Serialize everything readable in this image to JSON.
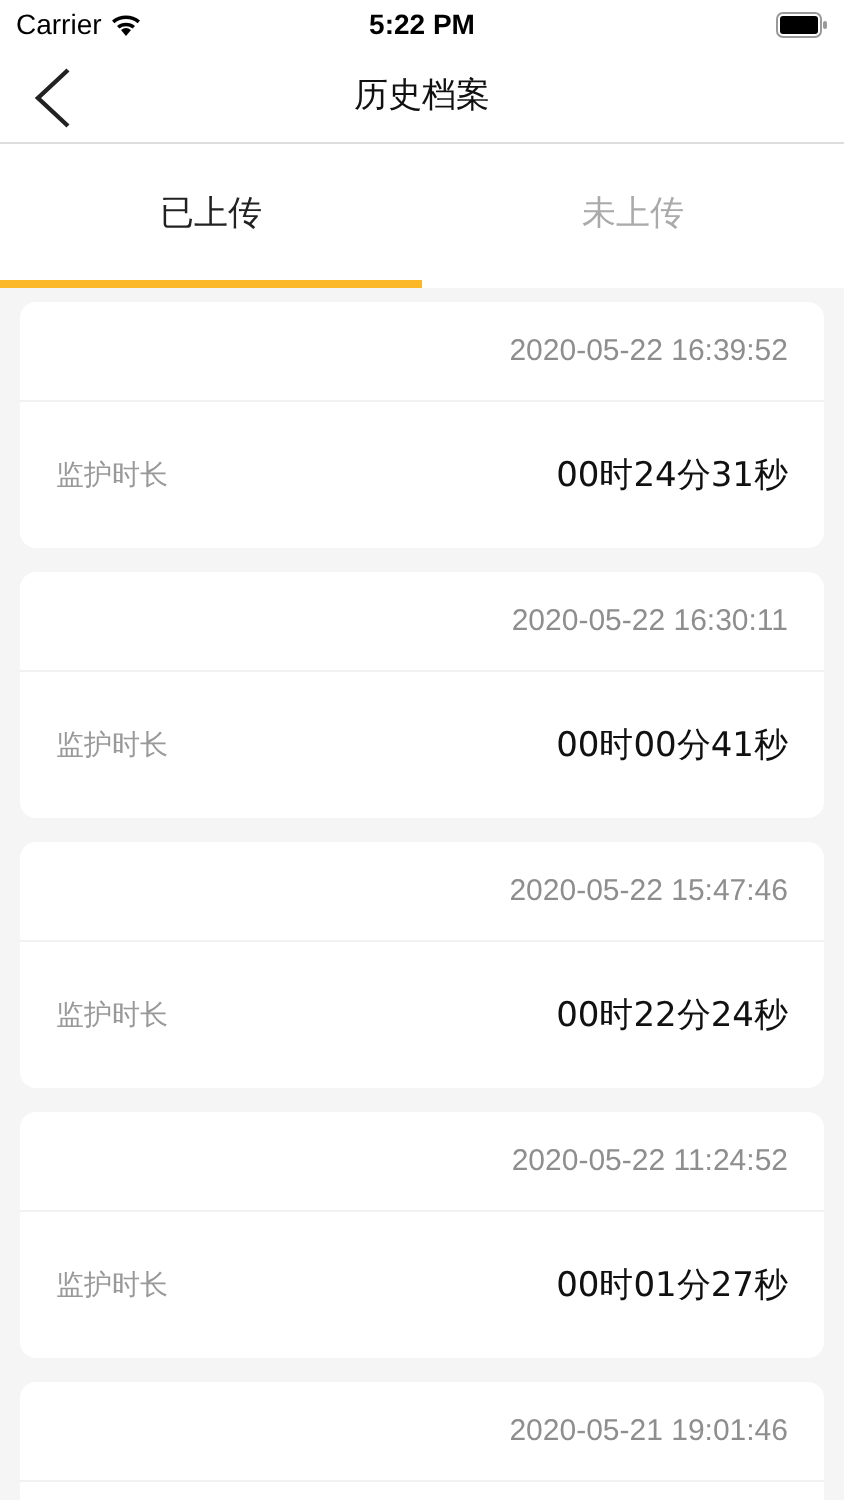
{
  "status_bar": {
    "carrier": "Carrier",
    "time": "5:22 PM"
  },
  "nav": {
    "title": "历史档案"
  },
  "tabs": [
    {
      "label": "已上传",
      "selected": true
    },
    {
      "label": "未上传",
      "selected": false
    }
  ],
  "records": [
    {
      "time": "2020-05-22 16:39:52",
      "label": "监护时长",
      "duration": "00时24分31秒"
    },
    {
      "time": "2020-05-22 16:30:11",
      "label": "监护时长",
      "duration": "00时00分41秒"
    },
    {
      "time": "2020-05-22 15:47:46",
      "label": "监护时长",
      "duration": "00时22分24秒"
    },
    {
      "time": "2020-05-22 11:24:52",
      "label": "监护时长",
      "duration": "00时01分27秒"
    },
    {
      "time": "2020-05-21 19:01:46"
    }
  ]
}
